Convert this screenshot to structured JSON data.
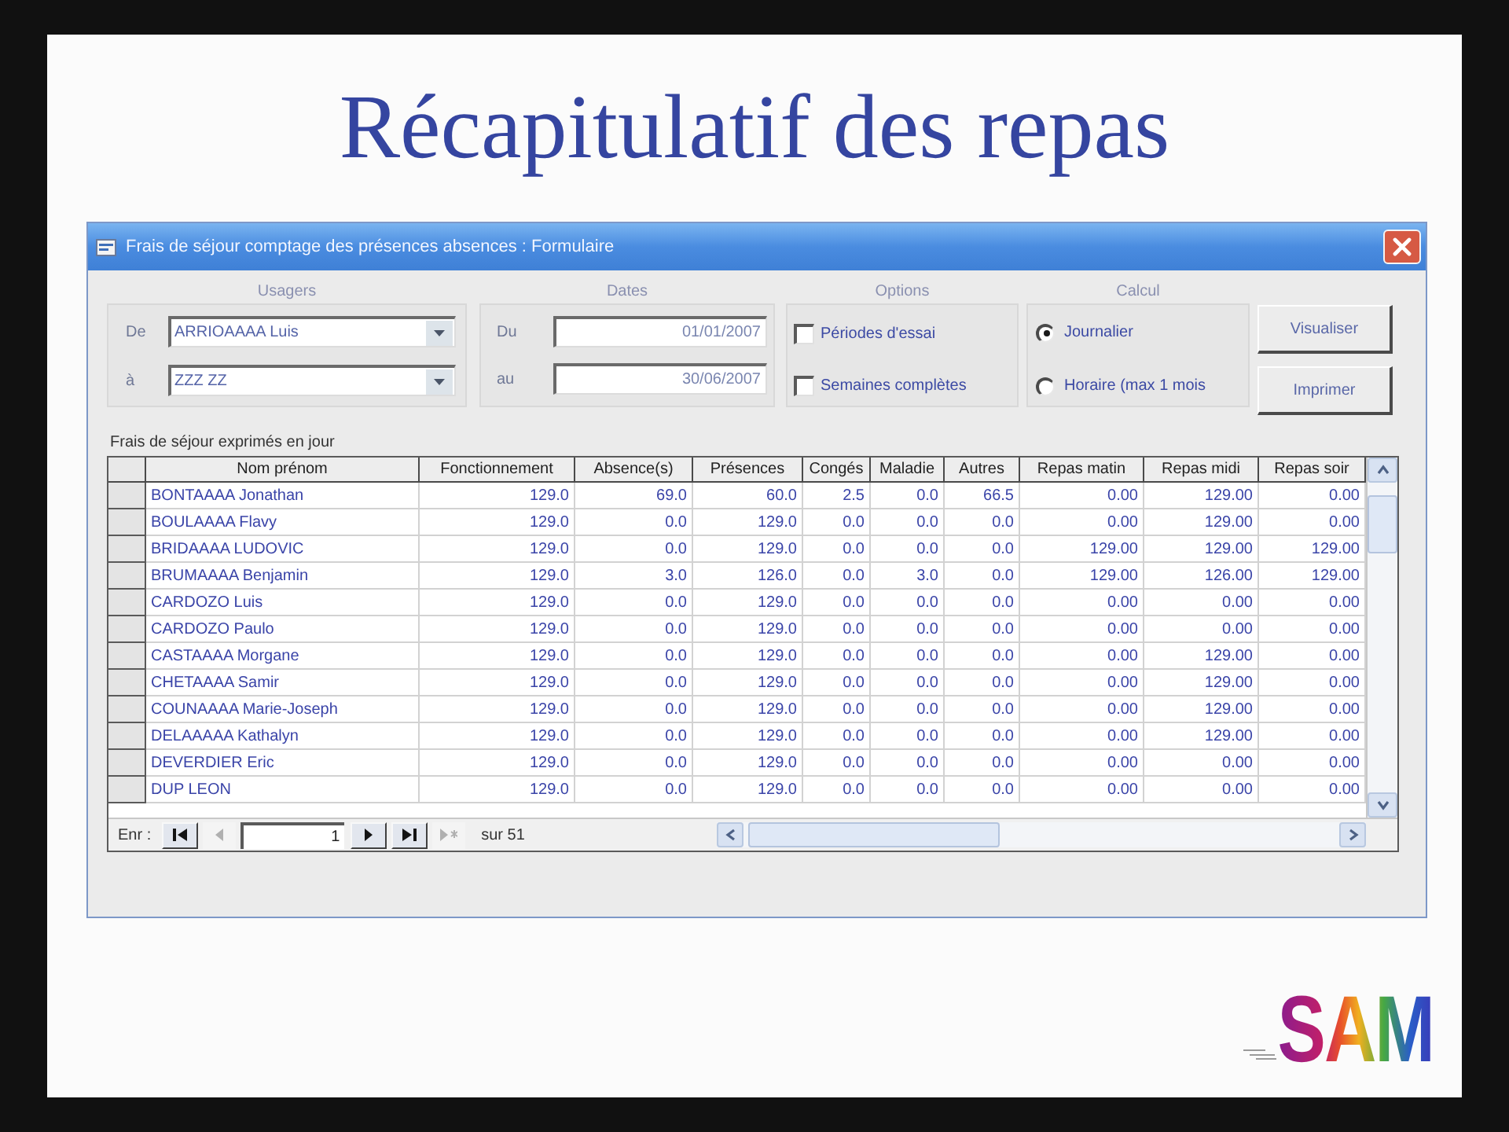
{
  "slide": {
    "title": "Récapitulatif des repas",
    "logo": "SAM"
  },
  "window": {
    "title": "Frais de séjour comptage des présences absences : Formulaire"
  },
  "usagers": {
    "label": "Usagers",
    "fields": [
      {
        "label": "De",
        "value": "ARRIOAAAA Luis"
      },
      {
        "label": "à",
        "value": "ZZZ ZZ"
      }
    ]
  },
  "dates": {
    "label": "Dates",
    "fields": [
      {
        "label": "Du",
        "value": "01/01/2007"
      },
      {
        "label": "au",
        "value": "30/06/2007"
      }
    ]
  },
  "options": {
    "label": "Options",
    "items": [
      {
        "label": "Périodes d'essai",
        "checked": false
      },
      {
        "label": "Semaines complètes",
        "checked": false
      }
    ]
  },
  "calcul": {
    "label": "Calcul",
    "items": [
      {
        "label": "Journalier",
        "selected": true
      },
      {
        "label": "Horaire (max 1 mois",
        "selected": false
      }
    ]
  },
  "buttons": [
    "Visualiser",
    "Imprimer"
  ],
  "table": {
    "caption": "Frais de séjour exprimés en jour",
    "columns": [
      "Nom prénom",
      "Fonctionnement",
      "Absence(s)",
      "Présences",
      "Congés",
      "Maladie",
      "Autres",
      "Repas matin",
      "Repas midi",
      "Repas soir"
    ],
    "rows": [
      {
        "cells": [
          "BONTAAAA Jonathan",
          "129.0",
          "69.0",
          "60.0",
          "2.5",
          "0.0",
          "66.5",
          "0.00",
          "129.00",
          "0.00"
        ]
      },
      {
        "cells": [
          "BOULAAAA Flavy",
          "129.0",
          "0.0",
          "129.0",
          "0.0",
          "0.0",
          "0.0",
          "0.00",
          "129.00",
          "0.00"
        ]
      },
      {
        "cells": [
          "BRIDAAAA LUDOVIC",
          "129.0",
          "0.0",
          "129.0",
          "0.0",
          "0.0",
          "0.0",
          "129.00",
          "129.00",
          "129.00"
        ]
      },
      {
        "cells": [
          "BRUMAAAA Benjamin",
          "129.0",
          "3.0",
          "126.0",
          "0.0",
          "3.0",
          "0.0",
          "129.00",
          "126.00",
          "129.00"
        ]
      },
      {
        "cells": [
          "CARDOZO Luis",
          "129.0",
          "0.0",
          "129.0",
          "0.0",
          "0.0",
          "0.0",
          "0.00",
          "0.00",
          "0.00"
        ]
      },
      {
        "cells": [
          "CARDOZO Paulo",
          "129.0",
          "0.0",
          "129.0",
          "0.0",
          "0.0",
          "0.0",
          "0.00",
          "0.00",
          "0.00"
        ]
      },
      {
        "cells": [
          "CASTAAAA Morgane",
          "129.0",
          "0.0",
          "129.0",
          "0.0",
          "0.0",
          "0.0",
          "0.00",
          "129.00",
          "0.00"
        ]
      },
      {
        "cells": [
          "CHETAAAA Samir",
          "129.0",
          "0.0",
          "129.0",
          "0.0",
          "0.0",
          "0.0",
          "0.00",
          "129.00",
          "0.00"
        ]
      },
      {
        "cells": [
          "COUNAAAA Marie-Joseph",
          "129.0",
          "0.0",
          "129.0",
          "0.0",
          "0.0",
          "0.0",
          "0.00",
          "129.00",
          "0.00"
        ]
      },
      {
        "cells": [
          "DELAAAAA Kathalyn",
          "129.0",
          "0.0",
          "129.0",
          "0.0",
          "0.0",
          "0.0",
          "0.00",
          "129.00",
          "0.00"
        ]
      },
      {
        "cells": [
          "DEVERDIER Eric",
          "129.0",
          "0.0",
          "129.0",
          "0.0",
          "0.0",
          "0.0",
          "0.00",
          "0.00",
          "0.00"
        ]
      },
      {
        "cells": [
          "DUP LEON",
          "129.0",
          "0.0",
          "129.0",
          "0.0",
          "0.0",
          "0.0",
          "0.00",
          "0.00",
          "0.00"
        ]
      }
    ]
  },
  "navigator": {
    "label": "Enr :",
    "record": "1",
    "total": "sur 51",
    "buttons": [
      {
        "kind": "first",
        "disabled": false
      },
      {
        "kind": "prev",
        "disabled": true
      },
      {
        "kind": "next",
        "disabled": false
      },
      {
        "kind": "last",
        "disabled": false
      },
      {
        "kind": "new",
        "disabled": true
      }
    ]
  }
}
